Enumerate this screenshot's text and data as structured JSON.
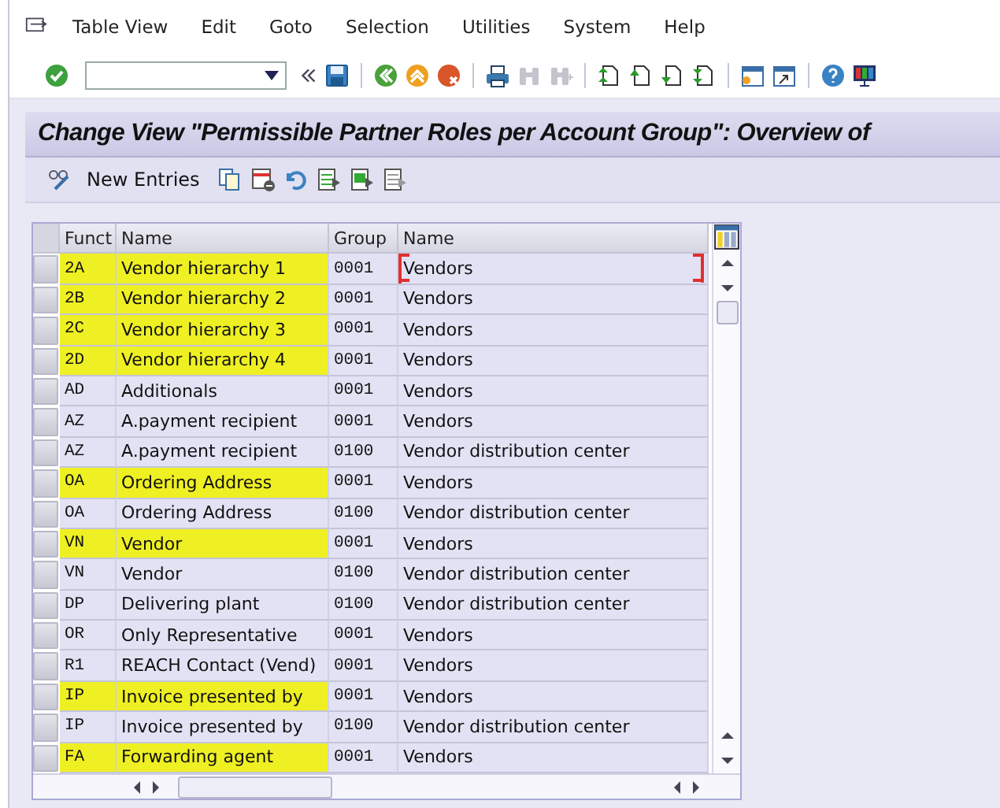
{
  "menu": [
    "Table View",
    "Edit",
    "Goto",
    "Selection",
    "Utilities",
    "System",
    "Help"
  ],
  "title": "Change View \"Permissible Partner Roles per Account Group\": Overview of",
  "app_toolbar": {
    "new_entries": "New Entries"
  },
  "table": {
    "columns": [
      "Funct",
      "Name",
      "Group",
      "Name"
    ],
    "rows": [
      {
        "funct": "2A",
        "name": "Vendor hierarchy 1",
        "group": "0001",
        "group_name": "Vendors",
        "highlighted": true,
        "focused": true
      },
      {
        "funct": "2B",
        "name": "Vendor hierarchy 2",
        "group": "0001",
        "group_name": "Vendors",
        "highlighted": true,
        "focused": false
      },
      {
        "funct": "2C",
        "name": "Vendor hierarchy 3",
        "group": "0001",
        "group_name": "Vendors",
        "highlighted": true,
        "focused": false
      },
      {
        "funct": "2D",
        "name": "Vendor hierarchy 4",
        "group": "0001",
        "group_name": "Vendors",
        "highlighted": true,
        "focused": false
      },
      {
        "funct": "AD",
        "name": "Additionals",
        "group": "0001",
        "group_name": "Vendors",
        "highlighted": false,
        "focused": false
      },
      {
        "funct": "AZ",
        "name": "A.payment recipient",
        "group": "0001",
        "group_name": "Vendors",
        "highlighted": false,
        "focused": false
      },
      {
        "funct": "AZ",
        "name": "A.payment recipient",
        "group": "0100",
        "group_name": "Vendor distribution center",
        "highlighted": false,
        "focused": false
      },
      {
        "funct": "OA",
        "name": "Ordering Address",
        "group": "0001",
        "group_name": "Vendors",
        "highlighted": true,
        "focused": false
      },
      {
        "funct": "OA",
        "name": "Ordering Address",
        "group": "0100",
        "group_name": "Vendor distribution center",
        "highlighted": false,
        "focused": false
      },
      {
        "funct": "VN",
        "name": "Vendor",
        "group": "0001",
        "group_name": "Vendors",
        "highlighted": true,
        "focused": false
      },
      {
        "funct": "VN",
        "name": "Vendor",
        "group": "0100",
        "group_name": "Vendor distribution center",
        "highlighted": false,
        "focused": false
      },
      {
        "funct": "DP",
        "name": "Delivering plant",
        "group": "0100",
        "group_name": "Vendor distribution center",
        "highlighted": false,
        "focused": false
      },
      {
        "funct": "OR",
        "name": "Only Representative",
        "group": "0001",
        "group_name": "Vendors",
        "highlighted": false,
        "focused": false
      },
      {
        "funct": "R1",
        "name": "REACH Contact (Vend)",
        "group": "0001",
        "group_name": "Vendors",
        "highlighted": false,
        "focused": false
      },
      {
        "funct": "IP",
        "name": "Invoice presented by",
        "group": "0001",
        "group_name": "Vendors",
        "highlighted": true,
        "focused": false
      },
      {
        "funct": "IP",
        "name": "Invoice presented by",
        "group": "0100",
        "group_name": "Vendor distribution center",
        "highlighted": false,
        "focused": false
      },
      {
        "funct": "FA",
        "name": "Forwarding agent",
        "group": "0001",
        "group_name": "Vendors",
        "highlighted": true,
        "focused": false
      }
    ]
  }
}
